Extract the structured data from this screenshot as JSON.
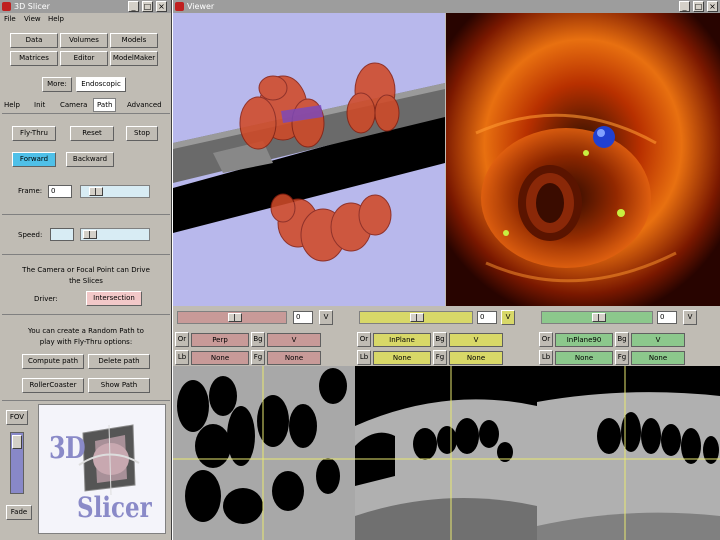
{
  "slicer_window": {
    "title": "3D Slicer",
    "menu": [
      "File",
      "View",
      "Help"
    ],
    "modules_row1": [
      "Data",
      "Volumes",
      "Models"
    ],
    "modules_row2": [
      "Matrices",
      "Editor",
      "ModelMaker"
    ],
    "extra": [
      "More:",
      "Endoscopic"
    ],
    "tabs": [
      "Help",
      "Init",
      "Camera",
      "Path",
      "Advanced"
    ],
    "active_tab": "Path",
    "path": {
      "fly_thru": "Fly-Thru",
      "reset": "Reset",
      "stop": "Stop",
      "forward": "Forward",
      "backward": "Backward",
      "frame_label": "Frame:",
      "frame_value": "0",
      "speed_label": "Speed:",
      "speed_value": "",
      "camera_text_1": "The Camera or Focal Point can Drive",
      "camera_text_2": "the Slices",
      "driver_label": "Driver:",
      "driver_value": "Intersection",
      "random_text_1": "You can create a Random Path to",
      "random_text_2": "play with Fly-Thru options:",
      "compute_path": "Compute path",
      "delete_path": "Delete path",
      "roller_coaster": "RollerCoaster",
      "show_path": "Show Path"
    },
    "bottom": {
      "top_button": "FOV",
      "fade_button": "Fade",
      "logo_3d": "3D",
      "logo_slicer": "Slicer"
    }
  },
  "viewer_window": {
    "title": "Viewer",
    "slices": [
      {
        "color": "#c89a98",
        "value": "0",
        "v_button": "V",
        "or_label": "Or",
        "or_value": "Perp",
        "bg_label": "Bg",
        "bg_value": "V",
        "fg_label": "Fg",
        "fg_value": "None",
        "lb_label": "Lb",
        "lb_value": "None"
      },
      {
        "color": "#d8d868",
        "value": "0",
        "v_button": "V",
        "or_label": "Or",
        "or_value": "InPlane",
        "bg_label": "Bg",
        "bg_value": "V",
        "fg_label": "Fg",
        "fg_value": "None",
        "lb_label": "Lb",
        "lb_value": "None"
      },
      {
        "color": "#8cc88c",
        "value": "0",
        "v_button": "V",
        "or_label": "Or",
        "or_value": "InPlane90",
        "bg_label": "Bg",
        "bg_value": "V",
        "fg_label": "Fg",
        "fg_value": "None",
        "lb_label": "Lb",
        "lb_value": "None"
      }
    ]
  },
  "colors": {
    "panel": "#c0bcb4",
    "title_bar": "#9d9d9d",
    "selected_button": "#4fc0e8",
    "view_bg": "#b8b8ec",
    "colon": "#d04a28"
  }
}
